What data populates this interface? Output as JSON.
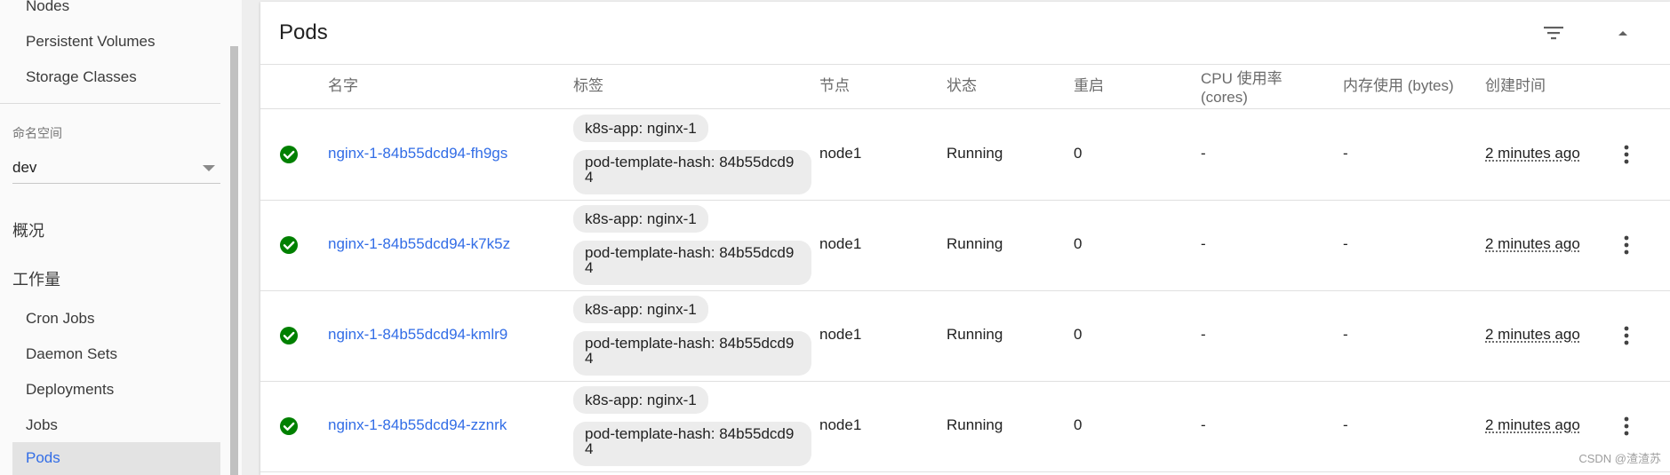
{
  "sidebar": {
    "cluster_items": [
      {
        "label": "Nodes"
      },
      {
        "label": "Persistent Volumes"
      },
      {
        "label": "Storage Classes"
      }
    ],
    "namespace_caption": "命名空间",
    "namespace_value": "dev",
    "overview_label": "概况",
    "workloads_label": "工作量",
    "workload_items": [
      {
        "label": "Cron Jobs"
      },
      {
        "label": "Daemon Sets"
      },
      {
        "label": "Deployments"
      },
      {
        "label": "Jobs"
      },
      {
        "label": "Pods"
      }
    ]
  },
  "pods_card": {
    "title": "Pods",
    "columns": {
      "name": "名字",
      "labels": "标签",
      "node": "节点",
      "status": "状态",
      "restarts": "重启",
      "cpu": "CPU 使用率 (cores)",
      "memory": "内存使用 (bytes)",
      "created": "创建时间"
    },
    "rows": [
      {
        "name": "nginx-1-84b55dcd94-fh9gs",
        "label_app": "k8s-app: nginx-1",
        "label_hash": "pod-template-hash: 84b55dcd94",
        "node": "node1",
        "status": "Running",
        "restarts": "0",
        "cpu": "-",
        "memory": "-",
        "created": "2 minutes ago"
      },
      {
        "name": "nginx-1-84b55dcd94-k7k5z",
        "label_app": "k8s-app: nginx-1",
        "label_hash": "pod-template-hash: 84b55dcd94",
        "node": "node1",
        "status": "Running",
        "restarts": "0",
        "cpu": "-",
        "memory": "-",
        "created": "2 minutes ago"
      },
      {
        "name": "nginx-1-84b55dcd94-kmlr9",
        "label_app": "k8s-app: nginx-1",
        "label_hash": "pod-template-hash: 84b55dcd94",
        "node": "node1",
        "status": "Running",
        "restarts": "0",
        "cpu": "-",
        "memory": "-",
        "created": "2 minutes ago"
      },
      {
        "name": "nginx-1-84b55dcd94-zznrk",
        "label_app": "k8s-app: nginx-1",
        "label_hash": "pod-template-hash: 84b55dcd94",
        "node": "node1",
        "status": "Running",
        "restarts": "0",
        "cpu": "-",
        "memory": "-",
        "created": "2 minutes ago"
      }
    ]
  },
  "icons": {
    "filter": "filter-icon",
    "collapse": "chevron-up-icon",
    "status_ok": "check-circle-icon",
    "row_menu": "more-vert-icon"
  },
  "colors": {
    "link": "#326de6",
    "status_ok": "#008000",
    "active_item_bg": "#e3e3e3"
  },
  "watermark": "CSDN @渣渣苏"
}
